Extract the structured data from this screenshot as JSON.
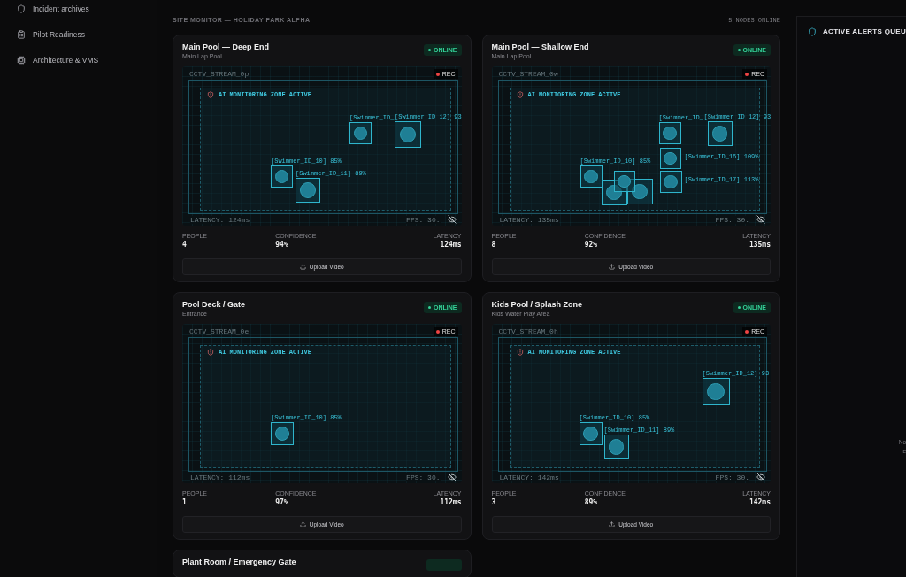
{
  "sidebar": {
    "items": [
      {
        "label": "Incident archives"
      },
      {
        "label": "Pilot Readiness"
      },
      {
        "label": "Architecture & VMS"
      }
    ]
  },
  "monitor": {
    "title": "SITE MONITOR — HOLIDAY PARK ALPHA",
    "nodes_online": "5 NODES ONLINE",
    "cameras": [
      {
        "name": "Main Pool — Deep End",
        "zone": "Main Lap Pool",
        "online": true,
        "status": "ONLINE",
        "stream": "CCTV_STREAM_0p",
        "rec": "REC",
        "overlay": "AI MONITORING ZONE ACTIVE",
        "latency_overlay": "LATENCY: 124ms",
        "fps": "FPS: 30.",
        "detections": [
          {
            "kind": "labeled",
            "label": "[Swimmer_ID_"
          },
          {
            "kind": "labeled",
            "label": "[Swimmer_ID_12] 93"
          },
          {
            "kind": "labeled",
            "label": "[Swimmer_ID_10] 85%"
          },
          {
            "kind": "labeled",
            "label": "[Swimmer_ID_11] 89%"
          }
        ],
        "stats": [
          {
            "label": "PEOPLE",
            "value": "4"
          },
          {
            "label": "CONFIDENCE",
            "value": "94%"
          },
          {
            "label": "LATENCY",
            "value": "124ms"
          }
        ],
        "upload": "Upload Video"
      },
      {
        "name": "Main Pool — Shallow End",
        "zone": "Main Lap Pool",
        "online": true,
        "status": "ONLINE",
        "stream": "CCTV_STREAM_0w",
        "rec": "REC",
        "overlay": "AI MONITORING ZONE ACTIVE",
        "latency_overlay": "LATENCY: 135ms",
        "fps": "FPS: 30.",
        "detections": [
          {
            "kind": "labeled",
            "label": "[Swimmer_ID_"
          },
          {
            "kind": "labeled",
            "label": "[Swimmer_ID_12] 93"
          },
          {
            "kind": "labeled",
            "label": "[Swimmer_ID_16] 109%"
          },
          {
            "kind": "labeled",
            "label": "[Swimmer_ID_17] 113%"
          },
          {
            "kind": "labeled",
            "label": "[Swimmer_ID_10] 85%"
          },
          {
            "kind": "unlabeled"
          },
          {
            "kind": "unlabeled"
          },
          {
            "kind": "unlabeled"
          }
        ],
        "stats": [
          {
            "label": "PEOPLE",
            "value": "8"
          },
          {
            "label": "CONFIDENCE",
            "value": "92%"
          },
          {
            "label": "LATENCY",
            "value": "135ms"
          }
        ],
        "upload": "Upload Video"
      },
      {
        "name": "Pool Deck / Gate",
        "zone": "Entrance",
        "online": true,
        "status": "ONLINE",
        "stream": "CCTV_STREAM_0e",
        "rec": "REC",
        "overlay": "AI MONITORING ZONE ACTIVE",
        "latency_overlay": "LATENCY: 112ms",
        "fps": "FPS: 30.",
        "detections": [
          {
            "kind": "labeled",
            "label": "[Swimmer_ID_10] 85%"
          }
        ],
        "stats": [
          {
            "label": "PEOPLE",
            "value": "1"
          },
          {
            "label": "CONFIDENCE",
            "value": "97%"
          },
          {
            "label": "LATENCY",
            "value": "112ms"
          }
        ],
        "upload": "Upload Video"
      },
      {
        "name": "Kids Pool / Splash Zone",
        "zone": "Kids Water Play Area",
        "online": true,
        "status": "ONLINE",
        "stream": "CCTV_STREAM_0h",
        "rec": "REC",
        "overlay": "AI MONITORING ZONE ACTIVE",
        "latency_overlay": "LATENCY: 142ms",
        "fps": "FPS: 30.",
        "detections": [
          {
            "kind": "labeled",
            "label": "[Swimmer_ID_12] 93"
          },
          {
            "kind": "labeled",
            "label": "[Swimmer_ID_10] 85%"
          },
          {
            "kind": "labeled",
            "label": "[Swimmer_ID_11] 89%"
          }
        ],
        "stats": [
          {
            "label": "PEOPLE",
            "value": "3"
          },
          {
            "label": "CONFIDENCE",
            "value": "89%"
          },
          {
            "label": "LATENCY",
            "value": "142ms"
          }
        ],
        "upload": "Upload Video"
      },
      {
        "name": "Plant Room / Emergency Gate",
        "online": true
      }
    ]
  },
  "alerts": {
    "title": "ACTIVE ALERTS QUEU",
    "empty_lines": [
      "No",
      "te"
    ]
  }
}
